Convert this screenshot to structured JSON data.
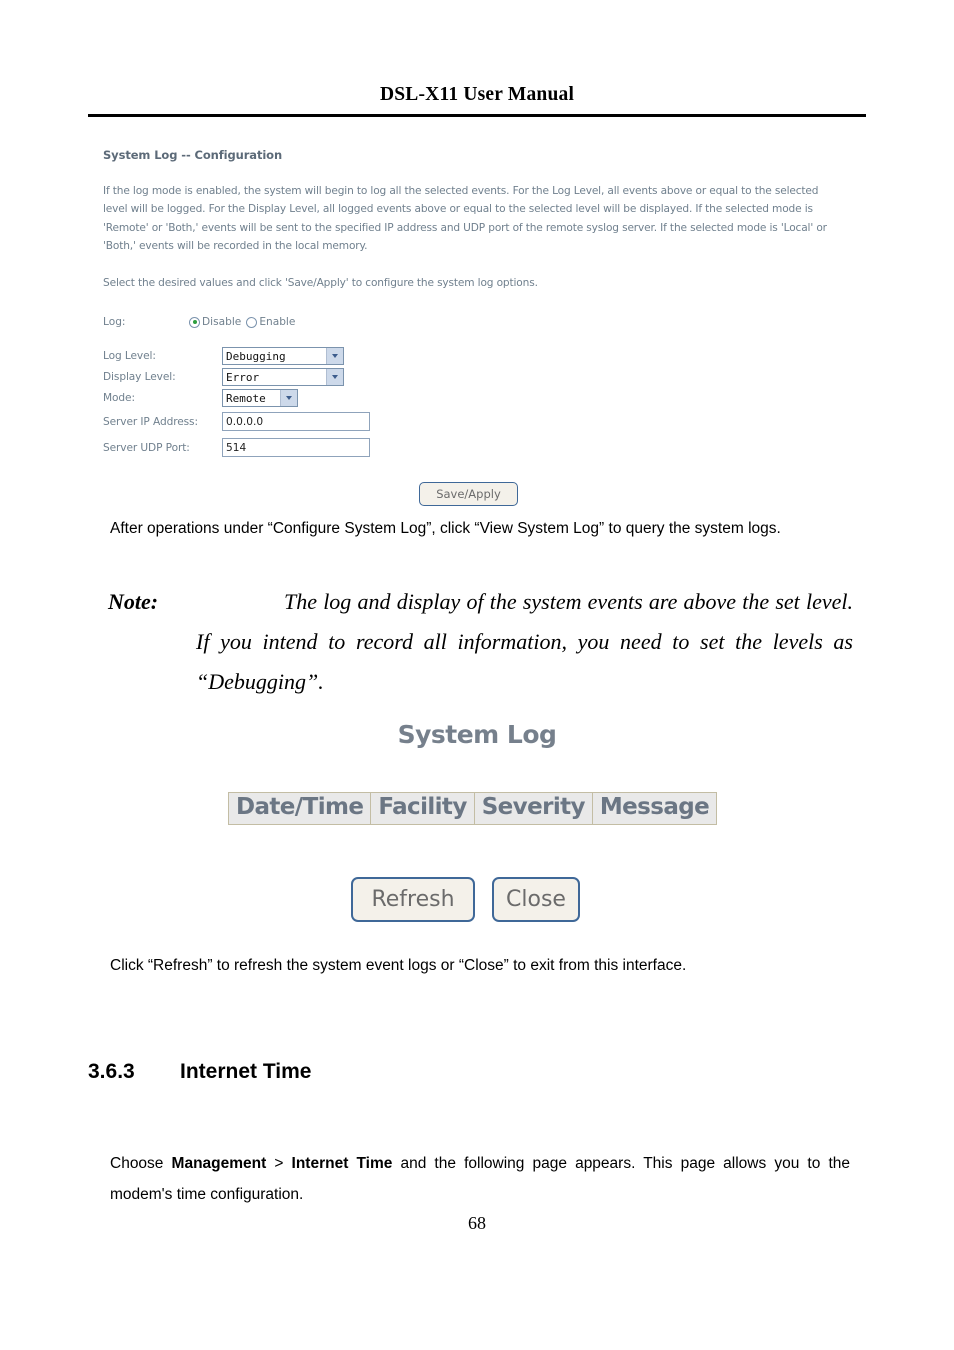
{
  "document": {
    "header_title": "DSL-X11 User Manual",
    "page_number": "68"
  },
  "webui_config": {
    "heading": "System Log -- Configuration",
    "description": "If the log mode is enabled, the system will begin to log all the selected events. For the Log Level, all events above or equal to the selected level will be logged. For the Display Level, all logged events above or equal to the selected level will be displayed. If the selected mode is 'Remote' or 'Both,' events will be sent to the specified IP address and UDP port of the remote syslog server. If the selected mode is 'Local' or 'Both,' events will be recorded in the local memory.",
    "instruction": "Select the desired values and click 'Save/Apply' to configure the system log options.",
    "log": {
      "label": "Log:",
      "options": [
        {
          "label": "Disable",
          "checked": true
        },
        {
          "label": "Enable",
          "checked": false
        }
      ]
    },
    "fields": {
      "log_level_label": "Log Level:",
      "log_level_value": "Debugging",
      "display_level_label": "Display Level:",
      "display_level_value": "Error",
      "mode_label": "Mode:",
      "mode_value": "Remote",
      "server_ip_label": "Server IP Address:",
      "server_ip_value": "0.0.0.0",
      "server_port_label": "Server UDP Port:",
      "server_port_value": "514"
    },
    "save_apply_label": "Save/Apply",
    "colors": {
      "heading": "#5c6a78",
      "body_text": "#70808e",
      "border": "#7b93ad",
      "radio_dot": "#2e9e3e",
      "select_arrow_bg": "#cdd9ea"
    }
  },
  "paragraphs": {
    "after_operations": "After operations under “Configure System Log”, click “View System Log” to query the system logs.",
    "note_label": "Note:",
    "note_body": "The log and display of the system events are above the set level. If you intend to record all information, you need to set the levels as “Debugging”.",
    "click_refresh": "Click “Refresh” to refresh the system event logs or “Close” to exit from this interface.",
    "choose_prefix": "Choose ",
    "choose_bold1": "Management",
    "choose_sep": " > ",
    "choose_bold2": "Internet Time",
    "choose_suffix": " and the following page appears. This page allows you to the modem's time configuration."
  },
  "syslog_viewer": {
    "title": "System Log",
    "columns": [
      "Date/Time",
      "Facility",
      "Severity",
      "Message"
    ],
    "refresh_label": "Refresh",
    "close_label": "Close",
    "colors": {
      "title": "#76808c",
      "cell_bg": "#e9e9e9",
      "cell_border": "#c3bda4",
      "button_border": "#3f6898",
      "button_bg": "#f4f1ea"
    }
  },
  "section": {
    "number": "3.6.3",
    "title": "Internet Time"
  }
}
